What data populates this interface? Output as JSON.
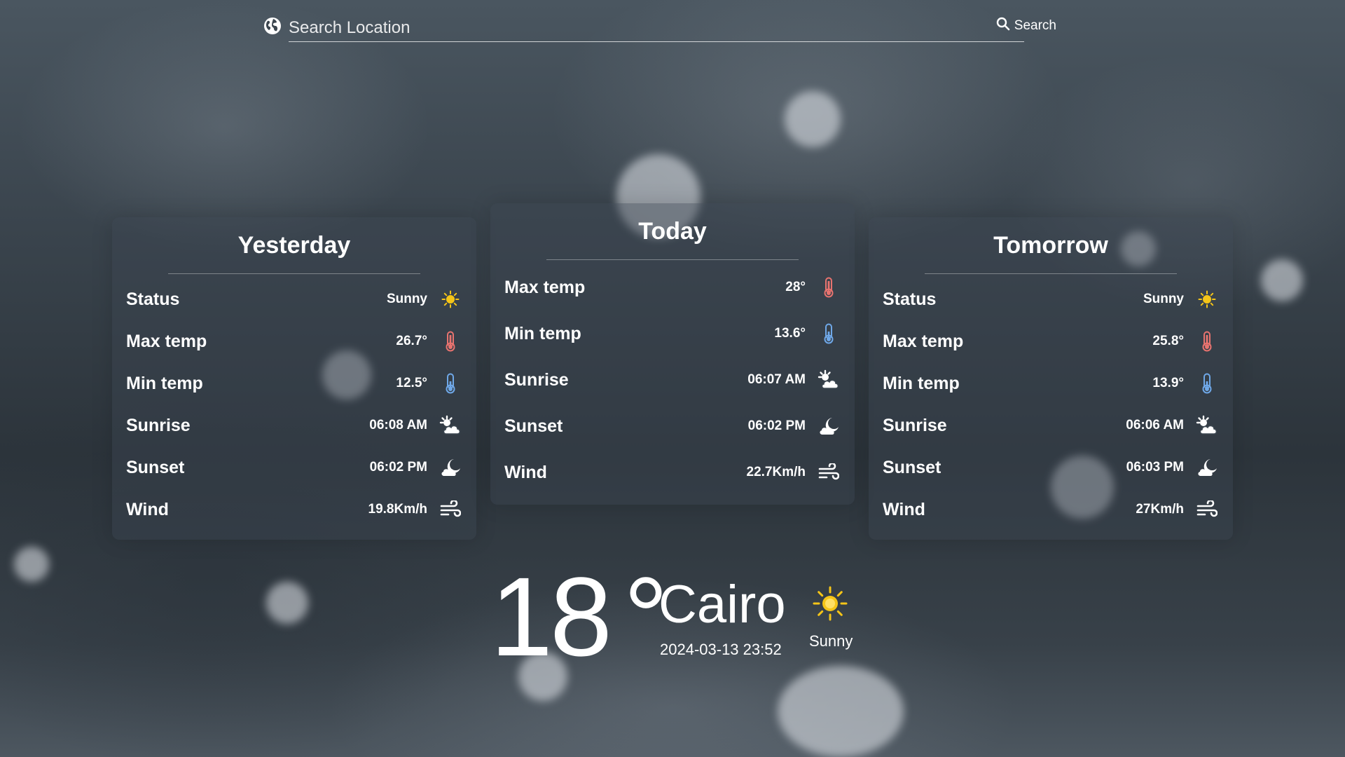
{
  "search": {
    "placeholder": "Search Location",
    "button_label": "Search"
  },
  "days": [
    {
      "id": "yesterday",
      "title": "Yesterday",
      "rows": [
        {
          "label": "Status",
          "value": "Sunny",
          "icon": "sun-icon"
        },
        {
          "label": "Max temp",
          "value": "26.7°",
          "icon": "thermometer-hot-icon"
        },
        {
          "label": "Min temp",
          "value": "12.5°",
          "icon": "thermometer-cold-icon"
        },
        {
          "label": "Sunrise",
          "value": "06:08 AM",
          "icon": "sunrise-icon"
        },
        {
          "label": "Sunset",
          "value": "06:02 PM",
          "icon": "sunset-icon"
        },
        {
          "label": "Wind",
          "value": "19.8Km/h",
          "icon": "wind-icon"
        }
      ]
    },
    {
      "id": "today",
      "title": "Today",
      "rows": [
        {
          "label": "Max temp",
          "value": "28°",
          "icon": "thermometer-hot-icon"
        },
        {
          "label": "Min temp",
          "value": "13.6°",
          "icon": "thermometer-cold-icon"
        },
        {
          "label": "Sunrise",
          "value": "06:07 AM",
          "icon": "sunrise-icon"
        },
        {
          "label": "Sunset",
          "value": "06:02 PM",
          "icon": "sunset-icon"
        },
        {
          "label": "Wind",
          "value": "22.7Km/h",
          "icon": "wind-icon"
        }
      ]
    },
    {
      "id": "tomorrow",
      "title": "Tomorrow",
      "rows": [
        {
          "label": "Status",
          "value": "Sunny",
          "icon": "sun-icon"
        },
        {
          "label": "Max temp",
          "value": "25.8°",
          "icon": "thermometer-hot-icon"
        },
        {
          "label": "Min temp",
          "value": "13.9°",
          "icon": "thermometer-cold-icon"
        },
        {
          "label": "Sunrise",
          "value": "06:06 AM",
          "icon": "sunrise-icon"
        },
        {
          "label": "Sunset",
          "value": "06:03 PM",
          "icon": "sunset-icon"
        },
        {
          "label": "Wind",
          "value": "27Km/h",
          "icon": "wind-icon"
        }
      ]
    }
  ],
  "current": {
    "temperature": "18",
    "degree_symbol": "°",
    "city": "Cairo",
    "datetime": "2024-03-13 23:52",
    "status": "Sunny",
    "icon": "sun-icon"
  },
  "colors": {
    "sun": "#f5c518",
    "thermometer_hot": "#e8736f",
    "thermometer_cold": "#6fa8e8",
    "text": "#ffffff"
  }
}
